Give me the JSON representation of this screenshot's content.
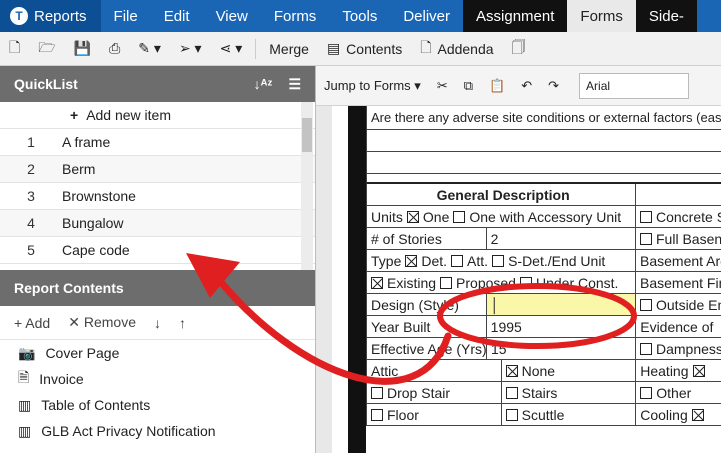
{
  "menubar": {
    "app": "Reports",
    "items": [
      "File",
      "Edit",
      "View",
      "Forms",
      "Tools",
      "Deliver"
    ],
    "dark": "Assignment",
    "active": "Forms",
    "tail": "Side-"
  },
  "toolbar": {
    "merge": "Merge",
    "contents": "Contents",
    "addenda": "Addenda"
  },
  "quicklist": {
    "title": "QuickList",
    "add": "Add new item",
    "items": [
      {
        "n": "1",
        "t": "A frame"
      },
      {
        "n": "2",
        "t": "Berm"
      },
      {
        "n": "3",
        "t": "Brownstone"
      },
      {
        "n": "4",
        "t": "Bungalow"
      },
      {
        "n": "5",
        "t": "Cape code"
      }
    ]
  },
  "report_contents": {
    "title": "Report Contents",
    "add": "Add",
    "remove": "Remove",
    "items": [
      "Cover Page",
      "Invoice",
      "Table of Contents",
      "GLB Act Privacy Notification"
    ]
  },
  "formtb": {
    "jump": "Jump to Forms",
    "font": "Arial"
  },
  "form": {
    "q_adverse": "Are there any adverse site conditions or external factors (ease",
    "general_desc": "General Description",
    "units": "Units",
    "one": "One",
    "one_acc": "One with Accessory Unit",
    "concrete": "Concrete S",
    "stories_label": "# of Stories",
    "stories_val": "2",
    "full_base": "Full Basen",
    "type": "Type",
    "det": "Det.",
    "att": "Att.",
    "sdet": "S-Det./End Unit",
    "base_area": "Basement Area",
    "existing": "Existing",
    "proposed": "Proposed",
    "under": "Under Const.",
    "base_fin": "Basement Finis",
    "design": "Design (Style)",
    "outside": "Outside En",
    "year_built": "Year Built",
    "year_val": "1995",
    "evidence": "Evidence of",
    "eff_age": "Effective Age (Yrs)",
    "eff_val": "15",
    "damp": "Dampness",
    "attic": "Attic",
    "none": "None",
    "heating": "Heating",
    "drop": "Drop Stair",
    "stairs": "Stairs",
    "other": "Other",
    "floor": "Floor",
    "scuttle": "Scuttle",
    "cooling": "Cooling"
  },
  "colors": {
    "brand": "#1a66b5",
    "annotation": "#e02020",
    "highlight": "#fbf7a8"
  }
}
